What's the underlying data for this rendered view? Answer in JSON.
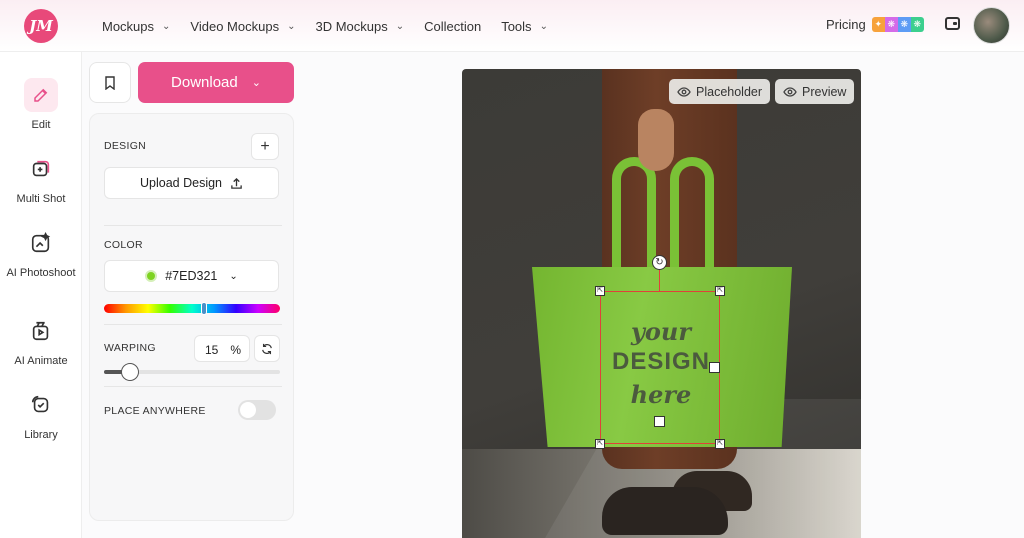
{
  "header": {
    "logo_text": "JM",
    "nav": [
      {
        "label": "Mockups",
        "has_dropdown": true
      },
      {
        "label": "Video Mockups",
        "has_dropdown": true
      },
      {
        "label": "3D Mockups",
        "has_dropdown": true
      },
      {
        "label": "Collection",
        "has_dropdown": false
      },
      {
        "label": "Tools",
        "has_dropdown": true
      }
    ],
    "pricing_label": "Pricing",
    "icons": [
      "wallet-icon",
      "avatar"
    ]
  },
  "sidebar": {
    "items": [
      {
        "label": "Edit",
        "icon": "pencil-icon",
        "active": true
      },
      {
        "label": "Multi Shot",
        "icon": "multi-shot-icon",
        "active": false
      },
      {
        "label": "AI Photoshoot",
        "icon": "ai-photoshoot-icon",
        "active": false
      },
      {
        "label": "AI Animate",
        "icon": "ai-animate-icon",
        "active": false
      },
      {
        "label": "Library",
        "icon": "library-icon",
        "active": false
      }
    ]
  },
  "toolbar": {
    "download_label": "Download",
    "bookmark_icon": "bookmark-icon"
  },
  "panel": {
    "design_label": "DESIGN",
    "upload_label": "Upload Design",
    "color_label": "COLOR",
    "color_value": "#7ED321",
    "hue_position": 0.57,
    "warping_label": "WARPING",
    "warping_value": "15",
    "warping_unit": "%",
    "place_anywhere_label": "PLACE ANYWHERE",
    "place_anywhere_on": false
  },
  "canvas": {
    "placeholder_label": "Placeholder",
    "preview_label": "Preview",
    "design_text": {
      "top": "your",
      "mid": "DESIGN",
      "bottom": "here"
    },
    "bag_color": "#7ED321"
  },
  "colors": {
    "accent": "#E8508A",
    "brand": "#E8497A"
  }
}
